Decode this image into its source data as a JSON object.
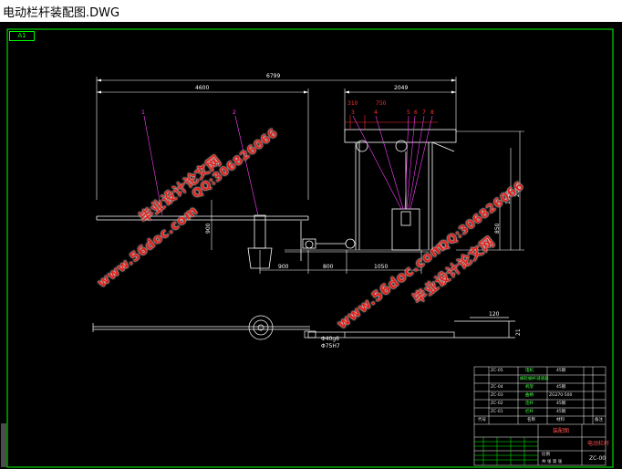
{
  "window": {
    "title": "电动栏杆装配图.DWG"
  },
  "sheet": {
    "size_tag": "A1"
  },
  "dimensions": {
    "overall_width": "6799",
    "left_span": "4600",
    "right_span": "2049",
    "d_310": "310",
    "d_750": "750",
    "d_900": "900",
    "d_900b": "900",
    "d_800": "800",
    "d_1050": "1050",
    "d_2000": "2000",
    "d_1940": "1940",
    "d_850": "850",
    "d_120": "120",
    "d_21": "21"
  },
  "fits": {
    "hole": "Φ40g6",
    "shaft": "Φ75H7"
  },
  "callouts": [
    "1",
    "2",
    "3",
    "4",
    "5",
    "6",
    "7",
    "8"
  ],
  "watermarks": {
    "site_a": "毕业设计论文网",
    "qq_a": "QQ:306826066",
    "url_a": "www.56doc.com",
    "site_b": "毕业设计论文网",
    "qq_b": "QQ:306826066",
    "url_b": "www.56doc.com"
  },
  "title_block": {
    "rows": [
      {
        "code": "ZC-05",
        "name": "电机",
        "qty": "1",
        "mat": "45钢"
      },
      {
        "code": "",
        "name": "蜗轮蜗杆减速器",
        "qty": "1",
        "mat": ""
      },
      {
        "code": "ZC-04",
        "name": "机架",
        "qty": "1",
        "mat": "45钢"
      },
      {
        "code": "ZC-03",
        "name": "曲柄",
        "qty": "1",
        "mat": "ZG270-500"
      },
      {
        "code": "ZC-02",
        "name": "连杆",
        "qty": "1",
        "mat": "45钢"
      },
      {
        "code": "ZC-01",
        "name": "栏杆",
        "qty": "1",
        "mat": "45钢"
      }
    ],
    "header": {
      "code": "代号",
      "name": "名称",
      "qty": "数量",
      "mat": "材料",
      "note": "备注"
    },
    "drawing_title": "装配图",
    "company": "电动栏杆",
    "drawing_no": "ZC-00",
    "scale_label": "比例",
    "sheet_label": "共 张 第 张"
  },
  "colors": {
    "background": "#000000",
    "frame": "#00ff00",
    "drawing": "#ffffff",
    "dimension": "#ff3030",
    "leader": "#ff40ff",
    "watermark": "#e0201a"
  }
}
